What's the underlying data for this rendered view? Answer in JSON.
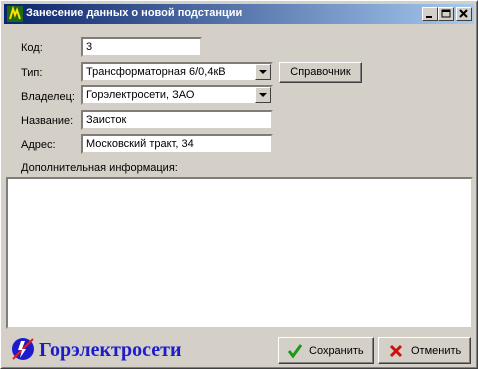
{
  "window": {
    "title": "Занесение данных о новой подстанции"
  },
  "form": {
    "code_label": "Код:",
    "code_value": "3",
    "type_label": "Тип:",
    "type_value": "Трансформаторная 6/0,4кВ",
    "reference_button": "Справочник",
    "owner_label": "Владелец:",
    "owner_value": "Горэлектросети, ЗАО",
    "name_label": "Название:",
    "name_value": "Заисток",
    "address_label": "Адрес:",
    "address_value": "Московский тракт, 34",
    "extra_label": "Дополнительная информация:",
    "extra_value": ""
  },
  "footer": {
    "brand": "Горэлектросети",
    "save_label": "Сохранить",
    "cancel_label": "Отменить"
  },
  "colors": {
    "title_gradient_start": "#0a246a",
    "title_gradient_end": "#a6caf0",
    "brand_text": "#1c1ccc",
    "save_icon": "#1a9a1a",
    "cancel_icon": "#cc1010"
  }
}
